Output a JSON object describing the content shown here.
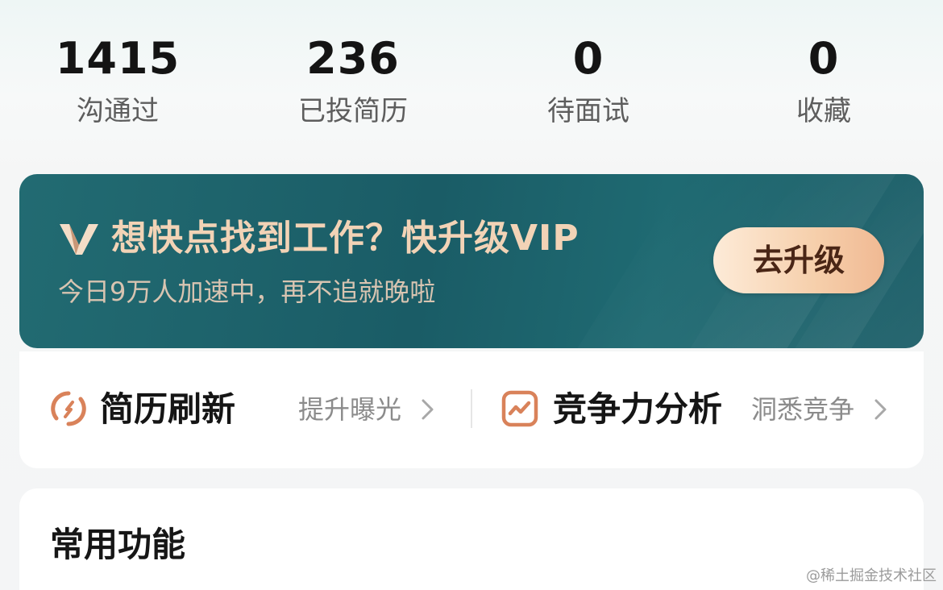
{
  "stats": [
    {
      "value": "1415",
      "label": "沟通过"
    },
    {
      "value": "236",
      "label": "已投简历"
    },
    {
      "value": "0",
      "label": "待面试"
    },
    {
      "value": "0",
      "label": "收藏"
    }
  ],
  "vip_banner": {
    "title": "想快点找到工作？快升级VIP",
    "subtitle": "今日9万人加速中，再不追就晚啦",
    "button_label": "去升级",
    "logo_icon": "vip-v-logo",
    "bg_color": "#1e636c",
    "text_color": "#f2d3b6"
  },
  "quick_actions": [
    {
      "icon": "refresh-icon",
      "title": "简历刷新",
      "subtitle": "提升曝光"
    },
    {
      "icon": "trend-chart-icon",
      "title": "竞争力分析",
      "subtitle": "洞悉竞争"
    }
  ],
  "common_functions": {
    "title": "常用功能"
  },
  "watermark": "@稀土掘金技术社区",
  "accent_color": "#d9825a"
}
